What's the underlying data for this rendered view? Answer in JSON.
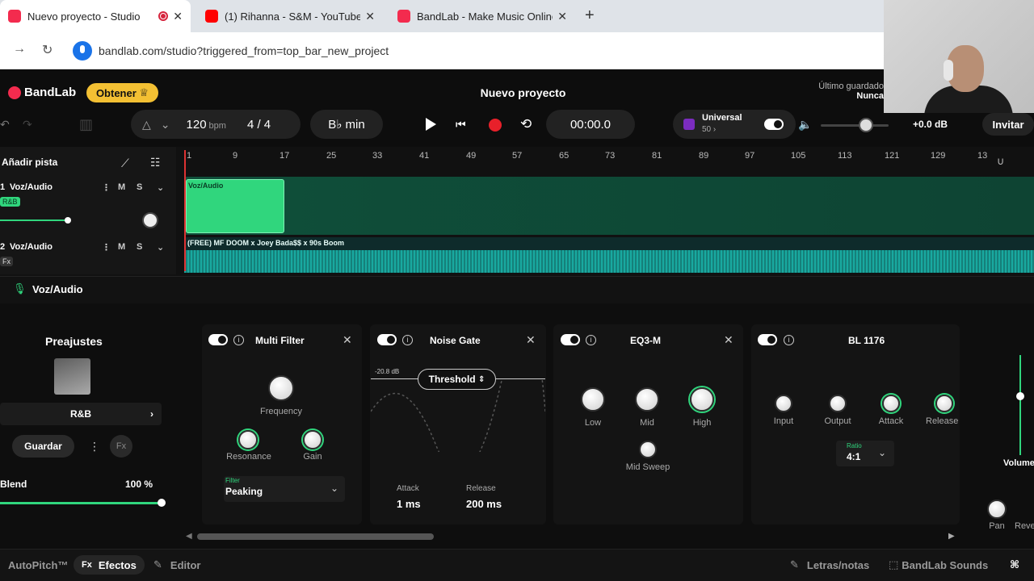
{
  "browser": {
    "tabs": [
      {
        "label": "Nuevo proyecto - Studio",
        "active": true,
        "fav_color": "#f32b4e"
      },
      {
        "label": "(1) Rihanna - S&M - YouTube",
        "active": false,
        "fav_color": "#ff0000"
      },
      {
        "label": "BandLab - Make Music Online",
        "active": false,
        "fav_color": "#f32b4e"
      }
    ],
    "new_tab": "+",
    "url": "bandlab.com/studio?triggered_from=top_bar_new_project"
  },
  "app": {
    "logo": "BandLab",
    "get_button": "Obtener",
    "project_title": "Nuevo proyecto",
    "saved_label": "Último guardado",
    "saved_value": "Nunca",
    "bpm": "120",
    "bpm_unit": "bpm",
    "time_signature": "4 / 4",
    "key": "B♭ min",
    "time": "00:00.0",
    "universal_label": "Universal",
    "universal_count": "50 ›",
    "master_db": "+0.0 dB",
    "invite": "Invitar",
    "accent": "#30d67d"
  },
  "tracks": {
    "add_track": "Añadir pista",
    "ruler": [
      "1",
      "9",
      "17",
      "25",
      "33",
      "41",
      "49",
      "57",
      "65",
      "73",
      "81",
      "89",
      "97",
      "105",
      "113",
      "121",
      "129",
      "13"
    ],
    "items": [
      {
        "number": "1",
        "name": "Voz/Audio",
        "preset": "R&B",
        "mute": "M",
        "solo": "S",
        "clip": "Voz/Audio"
      },
      {
        "number": "2",
        "name": "Voz/Audio",
        "preset": "Fx",
        "mute": "M",
        "solo": "S",
        "clip": "(FREE) MF DOOM x Joey Bada$$ x 90s Boom"
      }
    ]
  },
  "fx": {
    "selected_track": "Voz/Audio",
    "presets_title": "Preajustes",
    "preset": "R&B",
    "save": "Guardar",
    "blend_label": "Blend",
    "blend_value": "100 %",
    "multifilter": {
      "title": "Multi Filter",
      "frequency": "Frequency",
      "resonance": "Resonance",
      "gain": "Gain",
      "filter_label": "Filter",
      "filter_value": "Peaking"
    },
    "noisegate": {
      "title": "Noise Gate",
      "threshold_db": "-20.8 dB",
      "threshold": "Threshold",
      "attack_label": "Attack",
      "attack_value": "1 ms",
      "release_label": "Release",
      "release_value": "200 ms"
    },
    "eq": {
      "title": "EQ3-M",
      "low": "Low",
      "mid": "Mid",
      "high": "High",
      "midsweep": "Mid Sweep"
    },
    "comp": {
      "title": "BL 1176",
      "input": "Input",
      "output": "Output",
      "attack": "Attack",
      "release": "Release",
      "ratio_label": "Ratio",
      "ratio_value": "4:1"
    },
    "volume": "Volume",
    "pan": "Pan",
    "reverb": "Reve"
  },
  "footer": {
    "autopitch": "AutoPitch™",
    "effects": "Efectos",
    "editor": "Editor",
    "lyrics": "Letras/notas",
    "sounds": "BandLab Sounds"
  }
}
